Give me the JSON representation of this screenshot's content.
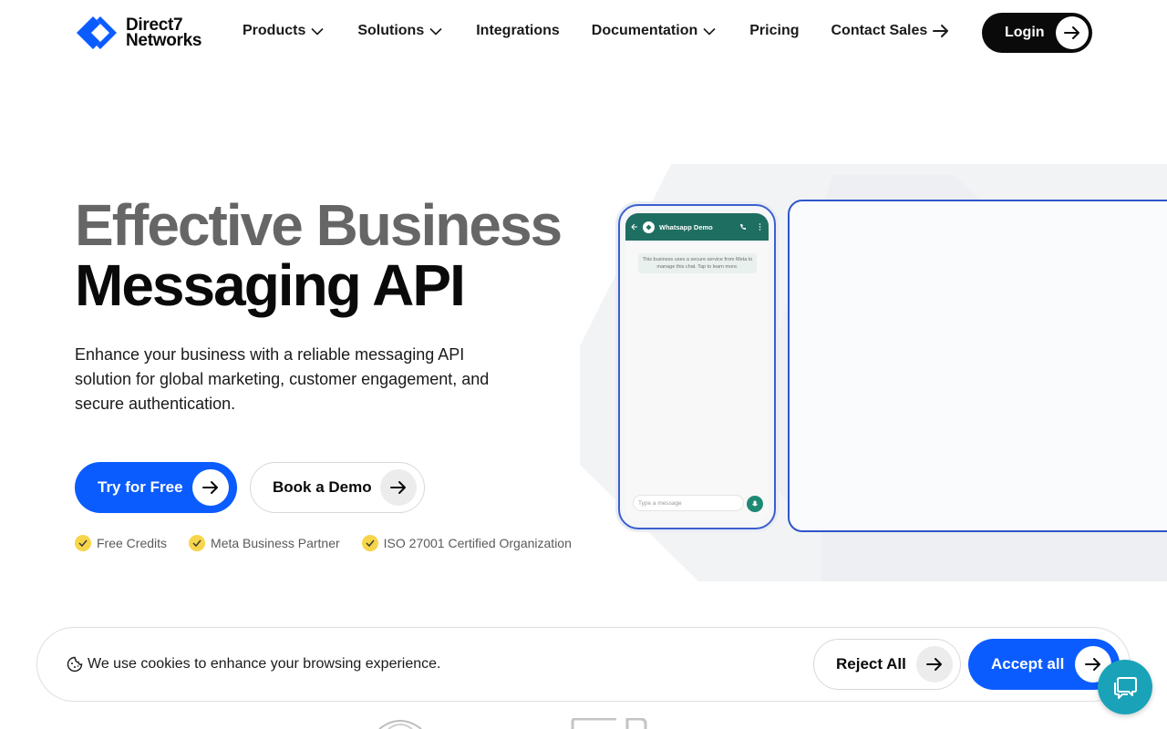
{
  "brand": {
    "line1": "Direct7",
    "line2": "Networks",
    "accent_color": "#0b5cff"
  },
  "nav": {
    "items": [
      {
        "label": "Products",
        "has_dropdown": true
      },
      {
        "label": "Solutions",
        "has_dropdown": true
      },
      {
        "label": "Integrations",
        "has_dropdown": false
      },
      {
        "label": "Documentation",
        "has_dropdown": true
      },
      {
        "label": "Pricing",
        "has_dropdown": false
      }
    ],
    "contact_label": "Contact Sales",
    "login_label": "Login"
  },
  "hero": {
    "title_line1": "Effective Business",
    "title_line2": "Messaging API",
    "description": "Enhance your business with a reliable messaging API solution for global marketing, customer engagement, and secure authentication.",
    "primary_cta": "Try for Free",
    "secondary_cta": "Book a Demo",
    "badges": [
      "Free Credits",
      "Meta Business Partner",
      "ISO 27001 Certified Organization"
    ]
  },
  "phone": {
    "chat_title": "Whatsapp Demo",
    "notice": "This business uses a secure service from Meta to manage this chat. Tap to learn more.",
    "input_placeholder": "Type a message"
  },
  "cookie": {
    "message": "We use cookies to enhance your browsing experience.",
    "reject_label": "Reject All",
    "accept_label": "Accept all"
  },
  "icons": {
    "arrow": "arrow-right-icon",
    "dropdown": "chevron-down-icon",
    "check": "check-icon",
    "cookie": "cookie-icon",
    "chat": "chat-icon"
  }
}
